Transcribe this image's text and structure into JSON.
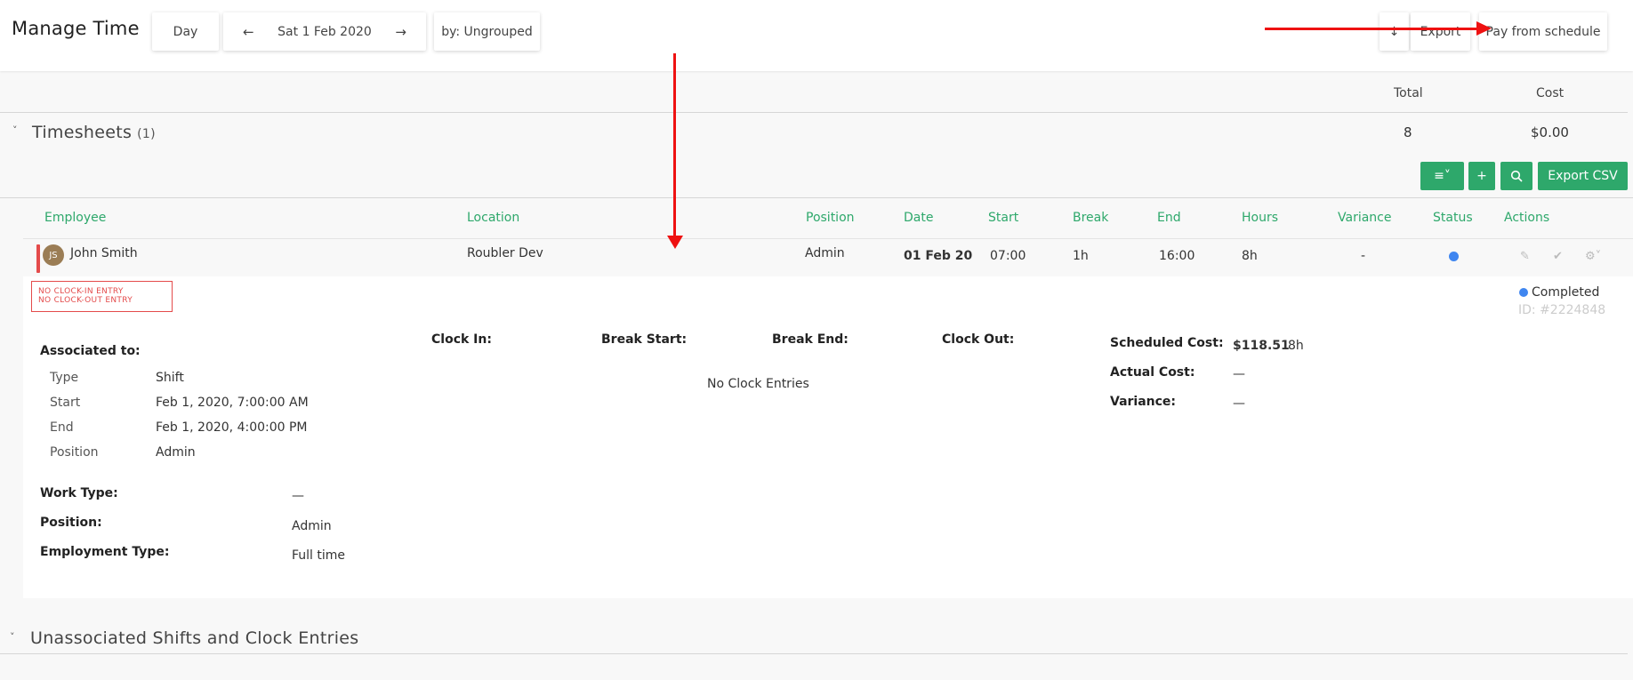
{
  "header": {
    "title": "Manage Time",
    "view_button": "Day",
    "prev_arrow": "←",
    "current_date": "Sat 1 Feb 2020",
    "next_arrow": "→",
    "group_button": "by: Ungrouped",
    "download_glyph": "↓",
    "export_button": "Export",
    "pay_button": "Pay from schedule"
  },
  "summary": {
    "total_label": "Total",
    "cost_label": "Cost"
  },
  "timesheets": {
    "caret": "˅",
    "title": "Timesheets",
    "count": "(1)",
    "total": "8",
    "cost": "$0.00",
    "toolbar": {
      "menu_glyph": "≡˅",
      "add_glyph": "+",
      "export_csv": "Export CSV"
    },
    "columns": [
      "Employee",
      "Location",
      "Position",
      "Date",
      "Start",
      "Break",
      "End",
      "Hours",
      "Variance",
      "Status",
      "Actions"
    ],
    "row": {
      "initials": "JS",
      "employee": "John Smith",
      "location": "Roubler Dev",
      "position": "Admin",
      "date": "01 Feb 20",
      "start": "07:00",
      "break": "1h",
      "end": "16:00",
      "hours": "8h",
      "variance": "-"
    },
    "detail": {
      "warning_1": "NO CLOCK-IN ENTRY",
      "warning_2": "NO CLOCK-OUT ENTRY",
      "status_text": "Completed",
      "record_id": "ID: #2224848",
      "associated_label": "Associated to:",
      "assoc": [
        {
          "key": "Type",
          "value": "Shift"
        },
        {
          "key": "Start",
          "value": "Feb 1, 2020, 7:00:00 AM"
        },
        {
          "key": "End",
          "value": "Feb 1, 2020, 4:00:00 PM"
        },
        {
          "key": "Position",
          "value": "Admin"
        }
      ],
      "work_type_label": "Work Type:",
      "work_type_value": "—",
      "position_label": "Position:",
      "position_value": "Admin",
      "employment_type_label": "Employment Type:",
      "employment_type_value": "Full time",
      "clock_in_label": "Clock In:",
      "break_start_label": "Break Start:",
      "break_end_label": "Break End:",
      "clock_out_label": "Clock Out:",
      "no_entries": "No Clock Entries",
      "scheduled_cost_label": "Scheduled Cost:",
      "scheduled_cost_value": "$118.51",
      "scheduled_hours": "8h",
      "actual_cost_label": "Actual Cost:",
      "actual_cost_value": "—",
      "variance_label": "Variance:",
      "variance_value": "—"
    }
  },
  "unassociated": {
    "caret": "˅",
    "title": "Unassociated Shifts and Clock Entries"
  },
  "colors": {
    "accent_green": "#2ea86b",
    "warning_red": "#e44b4b",
    "status_blue": "#3f86f0",
    "annotation_red": "#ee1111"
  }
}
